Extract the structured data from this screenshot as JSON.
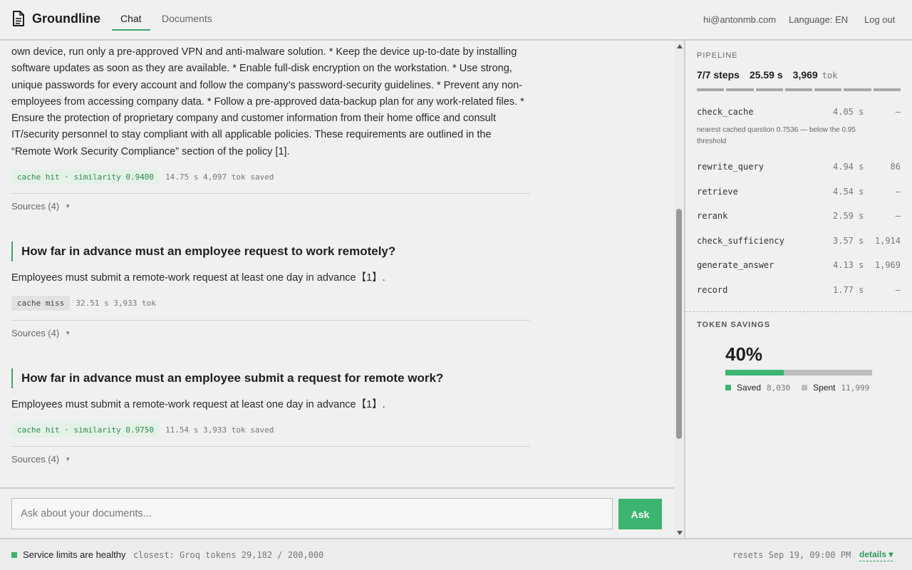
{
  "app": {
    "name": "Groundline",
    "tabs": [
      {
        "label": "Chat",
        "active": true
      },
      {
        "label": "Documents",
        "active": false
      }
    ],
    "user_email": "hi@antonmb.com",
    "language": "Language: EN",
    "logout": "Log out",
    "accent_color": "#3bb56f"
  },
  "chat": {
    "first_answer": "own device, run only a pre-approved VPN and anti-malware solution. * Keep the device up-to-date by installing software updates as soon as they are available. * Enable full-disk encryption on the workstation. * Use strong, unique passwords for every account and follow the company’s password-security guidelines. * Prevent any non-employees from accessing company data. * Follow a pre-approved data-backup plan for any work-related files. * Ensure the protection of proprietary company and customer information from their home office and consult IT/security personnel to stay compliant with all applicable policies. These requirements are outlined in the “Remote Work Security Compliance” section of the policy [1].",
    "first_meta": {
      "badge": "cache hit · similarity 0.9400",
      "stats": "14.75 s  4,097 tok saved"
    },
    "first_sources": "Sources (4)",
    "messages": [
      {
        "question": "How far in advance must an employee request to work remotely?",
        "answer": "Employees must submit a remote-work request at least one day in advance【1】.",
        "badge": "cache miss",
        "stats": "32.51 s  3,933 tok",
        "sources": "Sources (4)"
      },
      {
        "question": "How far in advance must an employee submit a request for remote work?",
        "answer": "Employees must submit a remote-work request at least one day in advance【1】.",
        "badge": "cache hit · similarity 0.9750",
        "stats": "11.54 s  3,933 tok saved",
        "sources": "Sources (4)"
      }
    ],
    "input_placeholder": "Ask about your documents...",
    "ask_label": "Ask"
  },
  "pipeline": {
    "title": "PIPELINE",
    "steps_summary": "7/7 steps",
    "total_time": "25.59 s",
    "total_tokens": "3,969",
    "tokens_unit": "tok",
    "steps": [
      {
        "name": "check_cache",
        "time": "4.05 s",
        "tokens": "—",
        "note": "nearest cached question 0.7536 — below the 0.95 threshold"
      },
      {
        "name": "rewrite_query",
        "time": "4.94 s",
        "tokens": "86"
      },
      {
        "name": "retrieve",
        "time": "4.54 s",
        "tokens": "—"
      },
      {
        "name": "rerank",
        "time": "2.59 s",
        "tokens": "—"
      },
      {
        "name": "check_sufficiency",
        "time": "3.57 s",
        "tokens": "1,914"
      },
      {
        "name": "generate_answer",
        "time": "4.13 s",
        "tokens": "1,969"
      },
      {
        "name": "record",
        "time": "1.77 s",
        "tokens": "—"
      }
    ]
  },
  "savings": {
    "title": "TOKEN SAVINGS",
    "percent": "40%",
    "saved_fraction": 0.4,
    "saved_label": "Saved",
    "saved_value": "8,030",
    "spent_label": "Spent",
    "spent_value": "11,999",
    "saved_color": "#3bb56f",
    "spent_color": "#bdbdbd"
  },
  "footer": {
    "status": "Service limits are healthy",
    "closest": "closest: Groq tokens 29,182 / 200,000",
    "resets": "resets Sep 19, 09:00 PM",
    "details": "details ▾"
  }
}
